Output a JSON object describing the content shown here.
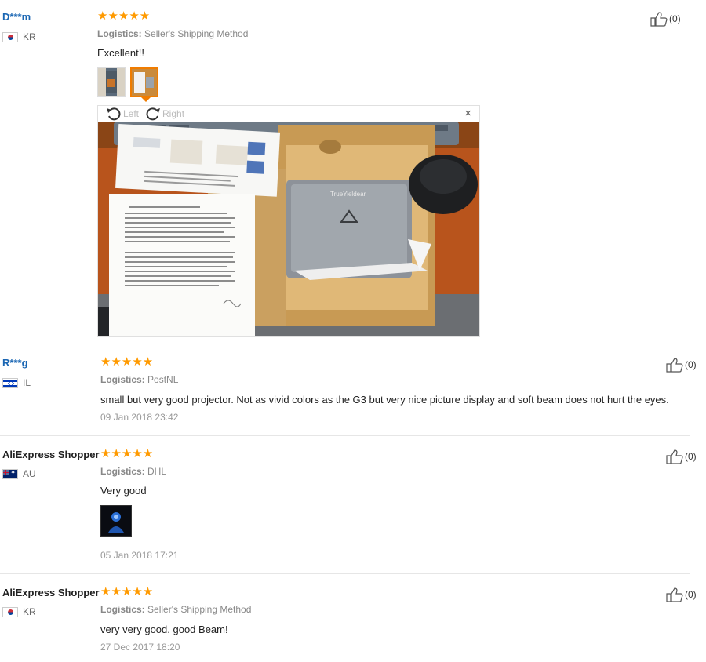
{
  "reviews": [
    {
      "user": "D***m",
      "country": "KR",
      "stars": "★★★★★",
      "logistics_label": "Logistics:",
      "logistics": "Seller's Shipping Method",
      "comment": "Excellent!!",
      "likes": "(0)",
      "viewer": {
        "rotate_left": "Left",
        "rotate_right": "Right",
        "close": "×"
      }
    },
    {
      "user": "R***g",
      "country": "IL",
      "stars": "★★★★★",
      "logistics_label": "Logistics:",
      "logistics": "PostNL",
      "comment": "small but very good projector. Not as vivid colors as the G3 but very nice picture display and soft beam does not hurt the eyes.",
      "date": "09 Jan 2018 23:42",
      "likes": "(0)"
    },
    {
      "user": "AliExpress Shopper",
      "country": "AU",
      "stars": "★★★★★",
      "logistics_label": "Logistics:",
      "logistics": "DHL",
      "comment": "Very good",
      "date": "05 Jan 2018 17:21",
      "likes": "(0)"
    },
    {
      "user": "AliExpress Shopper",
      "country": "KR",
      "stars": "★★★★★",
      "logistics_label": "Logistics:",
      "logistics": "Seller's Shipping Method",
      "comment": "very very good. good Beam!",
      "date": "27 Dec 2017 18:20",
      "likes": "(0)"
    }
  ],
  "colors": {
    "accent_star": "#ff9a00",
    "link": "#1a66b3",
    "thumb_active": "#f07c00"
  },
  "icons": {
    "like": "thumbs-up-icon",
    "rotate_left": "rotate-left-icon",
    "rotate_right": "rotate-right-icon",
    "close": "close-icon"
  }
}
